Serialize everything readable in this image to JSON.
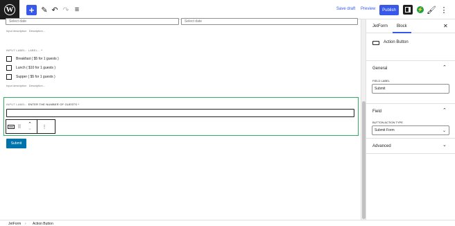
{
  "topbar": {
    "logo_glyph": "W",
    "add_symbol": "+",
    "save_draft": "Save draft",
    "preview": "Preview",
    "publish": "Publish",
    "jet_glyph": "⚡",
    "more_glyph": "⋮",
    "pen_glyph": "✎",
    "undo_glyph": "↶",
    "redo_glyph": "↷",
    "list_glyph": "≡",
    "brush_glyph": "🖌"
  },
  "form": {
    "date_placeholder_1": "Select date",
    "date_placeholder_2": "Select date",
    "input_description": "Input description",
    "description_text": "Description...",
    "checkbox_label_prefix": "INPUT LABEL:",
    "checkbox_label_value": "LABEL...",
    "required_star": "*",
    "options": [
      "Breakfast ( $5 for 1 guests )",
      "Lunch ( $10 for 1 guests )",
      "Supper ( $5 for 1 guests )"
    ],
    "input_description_2": "Input description",
    "description_text_2": "Description...",
    "guests_label_prefix": "INPUT LABEL:",
    "guests_label_value": "ENTER THE NUMBER OF GUESTS",
    "submit_label": "Submit"
  },
  "block_toolbar": {
    "drag_glyph": "⠿",
    "up_glyph": "⌃",
    "down_glyph": "⌄",
    "more_glyph": "⋮"
  },
  "sidebar": {
    "tabs": [
      "JetForm",
      "Block"
    ],
    "close_glyph": "✕",
    "block_name": "Action Button",
    "general_title": "General",
    "field_label_caption": "FIELD LABEL",
    "field_label_value": "Submit",
    "field_title": "Field",
    "action_type_caption": "BUTTON ACTION TYPE",
    "action_type_value": "Submit Form",
    "advanced_title": "Advanced",
    "chev_up": "⌃",
    "chev_down": "⌄"
  },
  "breadcrumb": {
    "items": [
      "JetForm",
      "Action Button"
    ],
    "separator": "›"
  },
  "colors": {
    "accent": "#3858e9",
    "selection": "#2cb25f",
    "submit": "#0073aa",
    "jet": "#18a34a"
  }
}
